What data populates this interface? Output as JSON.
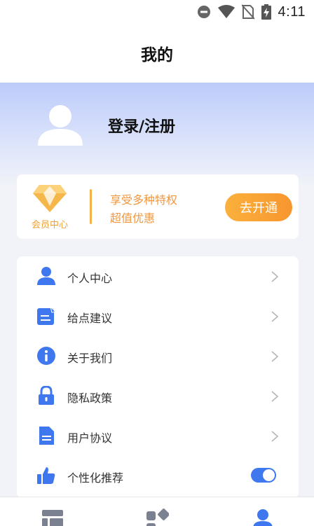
{
  "status_bar": {
    "time": "4:11",
    "icons": [
      "dnd-icon",
      "wifi-icon",
      "no-sim-icon",
      "battery-charging-icon"
    ]
  },
  "header": {
    "title": "我的"
  },
  "profile": {
    "login_label": "登录/注册",
    "avatar_icon": "user-avatar-icon"
  },
  "vip": {
    "label": "会员中心",
    "line1": "享受多种特权",
    "line2": "超值优惠",
    "button_label": "去开通",
    "accent_color": "#f7962f"
  },
  "menu": {
    "items": [
      {
        "label": "个人中心",
        "icon": "person-icon"
      },
      {
        "label": "给点建议",
        "icon": "feedback-icon"
      },
      {
        "label": "关于我们",
        "icon": "info-icon"
      },
      {
        "label": "隐私政策",
        "icon": "lock-icon"
      },
      {
        "label": "用户协议",
        "icon": "document-icon"
      },
      {
        "label": "个性化推荐",
        "icon": "thumbs-up-icon",
        "toggle_on": true
      }
    ]
  },
  "bottom_nav": {
    "tabs": [
      {
        "icon": "list-icon",
        "active": false
      },
      {
        "icon": "apps-icon",
        "active": false
      },
      {
        "icon": "profile-icon",
        "active": true
      }
    ]
  },
  "colors": {
    "primary": "#3f78ee",
    "vip_orange": "#f7962f",
    "background": "#f2f3f8"
  }
}
